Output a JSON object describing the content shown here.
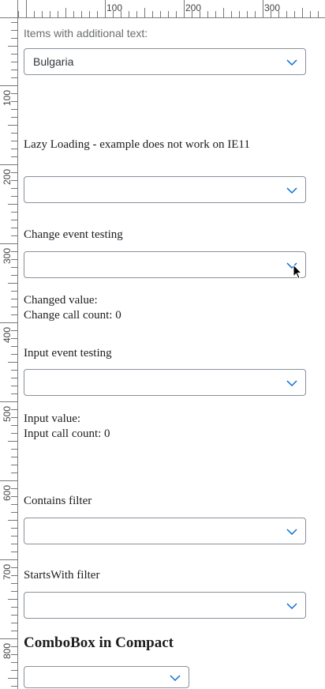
{
  "ruler": {
    "top_labels": [
      "100",
      "200",
      "300"
    ],
    "left_labels": [
      "100",
      "200",
      "300",
      "400",
      "500",
      "600",
      "700",
      "800"
    ]
  },
  "sections": {
    "additional_text": {
      "label": "Items with additional text:",
      "value": "Bulgaria"
    },
    "lazy_loading": {
      "label": "Lazy Loading - example does not work on IE11",
      "value": ""
    },
    "change_event": {
      "label": "Change event testing",
      "value": "",
      "changed_value": "Changed value:",
      "change_count": "Change call count: 0"
    },
    "input_event": {
      "label": "Input event testing",
      "value": "",
      "input_value": "Input value:",
      "input_count": "Input call count: 0"
    },
    "contains_filter": {
      "label": "Contains filter",
      "value": ""
    },
    "startswith_filter": {
      "label": "StartsWith filter",
      "value": ""
    },
    "compact": {
      "heading": "ComboBox in Compact",
      "value": ""
    }
  },
  "colors": {
    "accent": "#0a6ed1",
    "border": "#89919a"
  },
  "icons": {
    "dropdown": "chevron-down-icon",
    "cursor": "mouse-pointer-icon"
  }
}
